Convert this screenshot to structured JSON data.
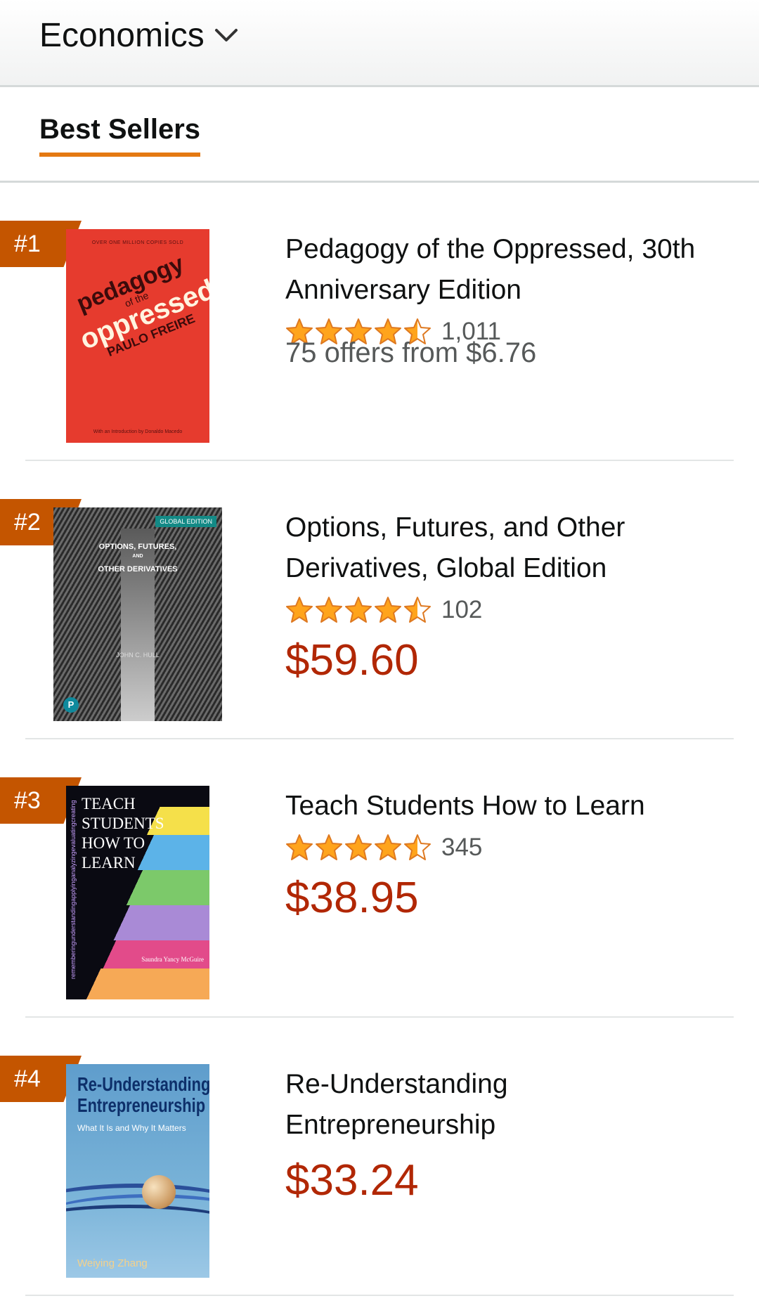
{
  "header": {
    "category": "Economics"
  },
  "tabs": {
    "active": "Best Sellers"
  },
  "colors": {
    "accent": "#e47911",
    "badge": "#c45500",
    "price": "#b12704",
    "star": "#ffa41c"
  },
  "items": [
    {
      "rank": "#1",
      "title": "Pedagogy of the Oppressed, 30th Anniversary Edition",
      "rating": 4.5,
      "rating_count": "1,011",
      "offers": "75 offers from $6.76",
      "cover": {
        "top": "OVER ONE MILLION COPIES SOLD",
        "line1": "pedagogy",
        "line2": "of the",
        "line3": "oppressed",
        "author": "PAULO FREIRE",
        "bottom": "With an Introduction by Donaldo Macedo"
      }
    },
    {
      "rank": "#2",
      "title": "Options, Futures, and Other Derivatives, Global Edition",
      "rating": 4.5,
      "rating_count": "102",
      "price": "$59.60",
      "cover": {
        "edition": "GLOBAL EDITION",
        "line1": "OPTIONS, FUTURES,",
        "line2": "AND",
        "line3": "OTHER DERIVATIVES",
        "author": "JOHN C. HULL",
        "logo": "P"
      }
    },
    {
      "rank": "#3",
      "title": "Teach Students How to Learn",
      "rating": 4.5,
      "rating_count": "345",
      "price": "$38.95",
      "cover": {
        "title": "TEACH STUDENTS HOW TO LEARN",
        "side": "rememberingunderstandingapplyinganalyzingevaluatingcreating",
        "author": "Saundra Yancy McGuire"
      }
    },
    {
      "rank": "#4",
      "title": "Re-Understanding Entrepreneurship",
      "price": "$33.24",
      "cover": {
        "title1": "Re-Understanding",
        "title2": "Entrepreneurship",
        "subtitle": "What It Is and Why It Matters",
        "author": "Weiying Zhang"
      }
    }
  ]
}
